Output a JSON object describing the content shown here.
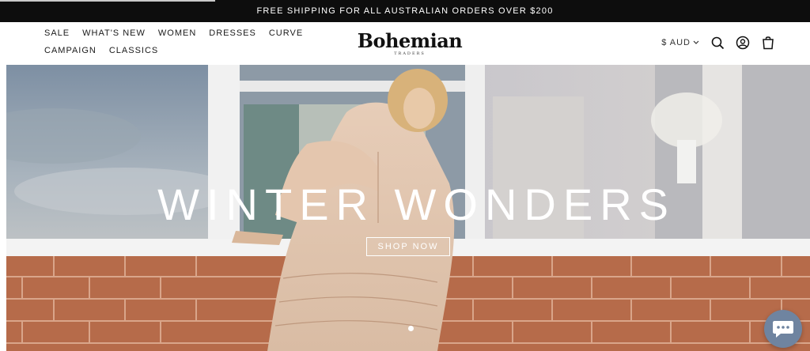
{
  "announcement": "FREE SHIPPING FOR ALL AUSTRALIAN ORDERS OVER $200",
  "nav": {
    "items": [
      "SALE",
      "WHAT'S NEW",
      "WOMEN",
      "DRESSES",
      "CURVE",
      "CAMPAIGN",
      "CLASSICS"
    ]
  },
  "logo": {
    "name": "Bohemian",
    "sub": "TRADERS"
  },
  "header_right": {
    "currency": "$ AUD",
    "icons": [
      "search-icon",
      "account-icon",
      "cart-icon",
      "chevron-down-icon"
    ]
  },
  "hero": {
    "title": "WINTER WONDERS",
    "button": "SHOP NOW",
    "slide_count": 1
  },
  "chat": {
    "icon": "chat-bubble-icon",
    "color": "#6f84a0"
  },
  "colors": {
    "announcement_bg": "#0d0d0d",
    "text": "#1a1a1a"
  }
}
